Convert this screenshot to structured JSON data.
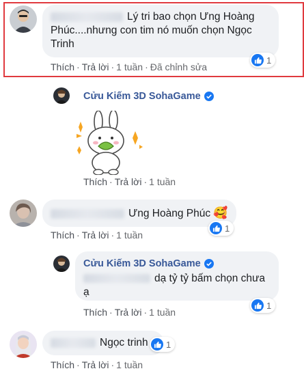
{
  "comments": [
    {
      "text": "Lý tri bao chọn Ưng Hoàng Phúc....nhưng con tim nó muốn chọn Ngọc Trinh",
      "reaction_count": "1",
      "actions": {
        "like": "Thích",
        "reply": "Trả lời",
        "time": "1 tuần",
        "edited": "Đã chỉnh sửa"
      }
    },
    {
      "author": "Cửu Kiếm 3D SohaGame",
      "sticker_icon": "bunny-sticker",
      "actions": {
        "like": "Thích",
        "reply": "Trả lời",
        "time": "1 tuần"
      }
    },
    {
      "text": "Ưng Hoàng Phúc",
      "emoji": "🥰",
      "reaction_count": "1",
      "actions": {
        "like": "Thích",
        "reply": "Trả lời",
        "time": "1 tuần"
      }
    },
    {
      "author": "Cửu Kiếm 3D SohaGame",
      "text": "dạ tỷ tỷ bấm chọn chưa ạ",
      "reaction_count": "1",
      "actions": {
        "like": "Thích",
        "reply": "Trả lời",
        "time": "1 tuần"
      }
    },
    {
      "text": "Ngọc trinh",
      "reaction_count": "1",
      "actions": {
        "like": "Thích",
        "reply": "Trả lời",
        "time": "1 tuần"
      }
    }
  ],
  "colors": {
    "highlight": "#e0393e",
    "like": "#1877f2",
    "author": "#385898",
    "bubble": "#f0f2f5"
  }
}
